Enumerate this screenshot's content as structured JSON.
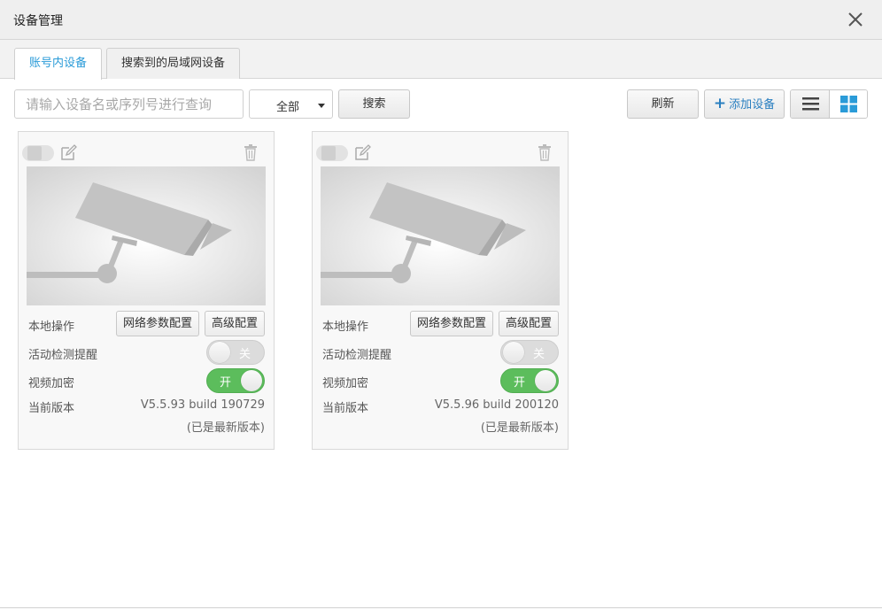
{
  "window": {
    "title": "设备管理",
    "close_icon": "close-icon"
  },
  "tabs": [
    {
      "label": "账号内设备",
      "active": true
    },
    {
      "label": "搜索到的局域网设备",
      "active": false
    }
  ],
  "toolbar": {
    "search_placeholder": "请输入设备名或序列号进行查询",
    "search_value": "",
    "filter_selected": "全部",
    "search_button": "搜索",
    "refresh_button": "刷新",
    "add_button": "添加设备",
    "view_modes": [
      "list",
      "grid"
    ],
    "active_view": "grid"
  },
  "labels": {
    "local_ops": "本地操作",
    "network_config": "网络参数配置",
    "advanced_config": "高级配置",
    "motion_alert": "活动检测提醒",
    "video_encrypt": "视频加密",
    "current_version": "当前版本",
    "switch_on": "开",
    "switch_off": "关"
  },
  "devices": [
    {
      "motion_alert": false,
      "video_encrypt": true,
      "version": "V5.5.93 build 190729",
      "version_status": "(已是最新版本)"
    },
    {
      "motion_alert": false,
      "video_encrypt": true,
      "version": "V5.5.96 build 200120",
      "version_status": "(已是最新版本)"
    }
  ],
  "colors": {
    "accent": "#2a9bd8",
    "switch_on": "#5cbd5c",
    "switch_off": "#dcdcdc",
    "grid_icon": "#2a9bd8"
  }
}
